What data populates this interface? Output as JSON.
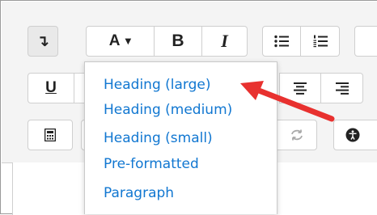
{
  "toolbar": {
    "row1": {
      "collapse_button": {
        "glyph": "↴",
        "icon": "collapse-toolbar-icon"
      },
      "paragraph_styles_button": {
        "letter": "A",
        "caret": "▼",
        "icon": "chevron-down-icon"
      },
      "bold_button": {
        "label": "B"
      },
      "italic_button": {
        "label": "I"
      },
      "unordered_list_button": {
        "icon": "unordered-list-icon"
      },
      "ordered_list_button": {
        "icon": "ordered-list-icon"
      }
    },
    "row2": {
      "underline_button": {
        "label": "U"
      },
      "align_center_button": {
        "icon": "align-center-icon"
      },
      "align_right_button": {
        "icon": "align-right-icon"
      }
    },
    "row3": {
      "calculator_button": {
        "icon": "calculator-icon"
      },
      "redo_button": {
        "icon": "redo-icon"
      },
      "accessibility_button": {
        "icon": "accessibility-icon"
      }
    }
  },
  "dropdown": {
    "items": [
      {
        "label": "Heading (large)"
      },
      {
        "label": "Heading (medium)"
      },
      {
        "label": "Heading (small)"
      },
      {
        "label": "Pre-formatted"
      },
      {
        "label": "Paragraph"
      }
    ]
  },
  "annotation": {
    "icon": "red-arrow-icon",
    "color": "#e8312f"
  },
  "colors": {
    "link": "#1177d1",
    "toolbar_bg": "#f4f4f4",
    "button_border": "#cfcfcf",
    "icon": "#222222"
  }
}
